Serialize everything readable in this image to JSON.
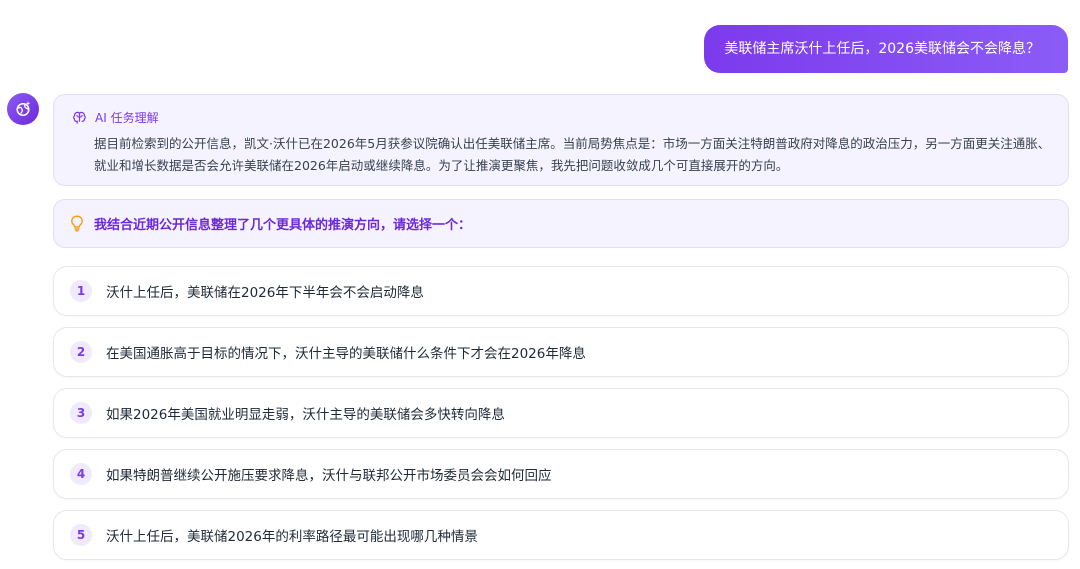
{
  "user_message": "美联储主席沃什上任后，2026美联储会不会降息？",
  "assistant": {
    "avatar_icon": "globe-sparkle-icon",
    "understanding": {
      "icon": "brain-icon",
      "title": "AI 任务理解",
      "body": "据目前检索到的公开信息，凯文·沃什已在2026年5月获参议院确认出任美联储主席。当前局势焦点是：市场一方面关注特朗普政府对降息的政治压力，另一方面更关注通胀、就业和增长数据是否会允许美联储在2026年启动或继续降息。为了让推演更聚焦，我先把问题收敛成几个可直接展开的方向。"
    },
    "prompt": {
      "icon": "lightbulb-icon",
      "text": "我结合近期公开信息整理了几个更具体的推演方向，请选择一个："
    },
    "options": [
      {
        "num": "1",
        "label": "沃什上任后，美联储在2026年下半年会不会启动降息"
      },
      {
        "num": "2",
        "label": "在美国通胀高于目标的情况下，沃什主导的美联储什么条件下才会在2026年降息"
      },
      {
        "num": "3",
        "label": "如果2026年美国就业明显走弱，沃什主导的美联储会多快转向降息"
      },
      {
        "num": "4",
        "label": "如果特朗普继续公开施压要求降息，沃什与联邦公开市场委员会会如何回应"
      },
      {
        "num": "5",
        "label": "沃什上任后，美联储2026年的利率路径最可能出现哪几种情景"
      }
    ]
  },
  "colors": {
    "accent": "#7c3aed",
    "card_bg": "#f5f3ff",
    "card_border": "#e4dcfb",
    "prompt_icon": "#f59e0b"
  }
}
